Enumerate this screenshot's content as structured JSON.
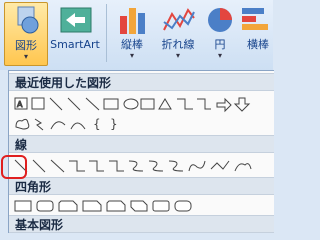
{
  "ribbon": {
    "shapes_label": "図形",
    "smartart_label": "SmartArt",
    "column_label": "縦棒",
    "line_label": "折れ線",
    "pie_label": "円",
    "bar_label": "横棒"
  },
  "dropdown": {
    "recent_header": "最近使用した図形",
    "lines_header": "線",
    "rectangles_header": "四角形",
    "basic_header": "基本図形"
  },
  "colors": {
    "highlight": "#e02020",
    "ribbon_bg": "#cddff3",
    "header_bg": "#dde5ee"
  }
}
